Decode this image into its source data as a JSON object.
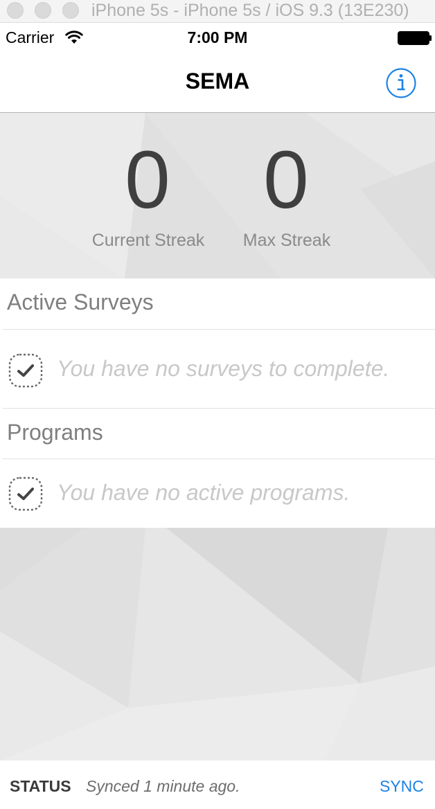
{
  "simulator": {
    "title": "iPhone 5s - iPhone 5s / iOS 9.3 (13E230)"
  },
  "status_bar": {
    "carrier": "Carrier",
    "time": "7:00 PM",
    "icons": [
      "wifi-icon",
      "battery-icon"
    ]
  },
  "nav": {
    "title": "SEMA",
    "info_icon": "info-icon"
  },
  "streaks": {
    "current_value": "0",
    "current_label": "Current Streak",
    "max_value": "0",
    "max_label": "Max Streak"
  },
  "sections": {
    "surveys": {
      "title": "Active Surveys",
      "empty_text": "You have no surveys to complete.",
      "icon": "dashed-check-icon"
    },
    "programs": {
      "title": "Programs",
      "empty_text": "You have no active programs.",
      "icon": "dashed-check-icon"
    }
  },
  "bottom_bar": {
    "status_label": "STATUS",
    "status_text": "Synced 1 minute ago.",
    "sync_label": "SYNC"
  },
  "colors": {
    "accent": "#1b82e6",
    "streak_number": "#3f3f3f",
    "muted_text": "#c8c8c8"
  }
}
